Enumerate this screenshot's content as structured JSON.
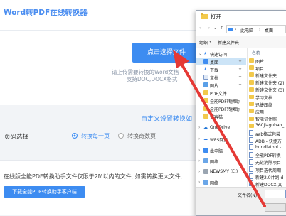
{
  "web": {
    "title": "Word转PDF在线转换器",
    "upload_button": "点击选择文件",
    "upload_hint_1": "请上传需要转换的Word文档",
    "upload_hint_2": "支持DOC,DOCX格式",
    "section_title": "自定义设置转换如",
    "page_select_label": "页码选择",
    "option_every_page": "转换每一页",
    "option_odd_page": "转换奇数页",
    "footer_note": "在线版全能PDF转换助手文件仅限于2M以内的文件, 如需转换更大文件,",
    "download_button": "下载全能PDF转换助手客户端"
  },
  "dialog": {
    "title": "打开",
    "breadcrumb_1": "此电脑",
    "breadcrumb_2": "桌面",
    "organize_label": "组织",
    "new_folder_label": "新建文件夹",
    "column_name": "名称",
    "filename_label": "文件名(N):",
    "nav_items": [
      {
        "label": "快速访问",
        "icon": "star-icon"
      },
      {
        "label": "桌面",
        "icon": "desktop-icon"
      },
      {
        "label": "下载",
        "icon": "download-icon"
      },
      {
        "label": "文档",
        "icon": "document-icon"
      },
      {
        "label": "图片",
        "icon": "picture-icon"
      },
      {
        "label": "PDF文件",
        "icon": "folder-icon"
      },
      {
        "label": "全能PDF转换助",
        "icon": "folder-icon"
      },
      {
        "label": "全能PDF转换助",
        "icon": "folder-icon"
      },
      {
        "label": "试客猫",
        "icon": "folder-icon"
      },
      {
        "label": "OneDrive",
        "icon": "cloud-icon"
      },
      {
        "label": "WPS网盘",
        "icon": "cloud-icon"
      },
      {
        "label": "此电脑",
        "icon": "computer-icon"
      },
      {
        "label": "网络",
        "icon": "network-icon"
      },
      {
        "label": "NEWSMY (E:)",
        "icon": "drive-icon"
      },
      {
        "label": "网络",
        "icon": "network-icon"
      }
    ],
    "files": [
      {
        "name": "图片",
        "type": "folder"
      },
      {
        "name": "项目",
        "type": "folder"
      },
      {
        "name": "新建文件夹",
        "type": "folder"
      },
      {
        "name": "新建文件夹 (2)",
        "type": "folder"
      },
      {
        "name": "新建文件夹 (3)",
        "type": "folder"
      },
      {
        "name": "学习文档",
        "type": "folder"
      },
      {
        "name": "迅捷压缩",
        "type": "folder"
      },
      {
        "name": "应用",
        "type": "folder"
      },
      {
        "name": "智能证件照",
        "type": "folder"
      },
      {
        "name": "360jiagubao_",
        "type": "folder"
      },
      {
        "name": "aab格式包装",
        "type": "doc"
      },
      {
        "name": "ADB - 快捷方",
        "type": "doc"
      },
      {
        "name": "bundletool -",
        "type": "doc"
      },
      {
        "name": "全能PDF转换",
        "type": "doc"
      },
      {
        "name": "无缝消除项目",
        "type": "doc"
      },
      {
        "name": "项目选代周期",
        "type": "doc"
      },
      {
        "name": "新建2.0计划.d",
        "type": "doc"
      },
      {
        "name": "新建DOCX 文",
        "type": "doc"
      }
    ]
  },
  "colors": {
    "accent": "#3d8cf1",
    "arrow": "#e53935",
    "folder": "#f2c94c"
  }
}
